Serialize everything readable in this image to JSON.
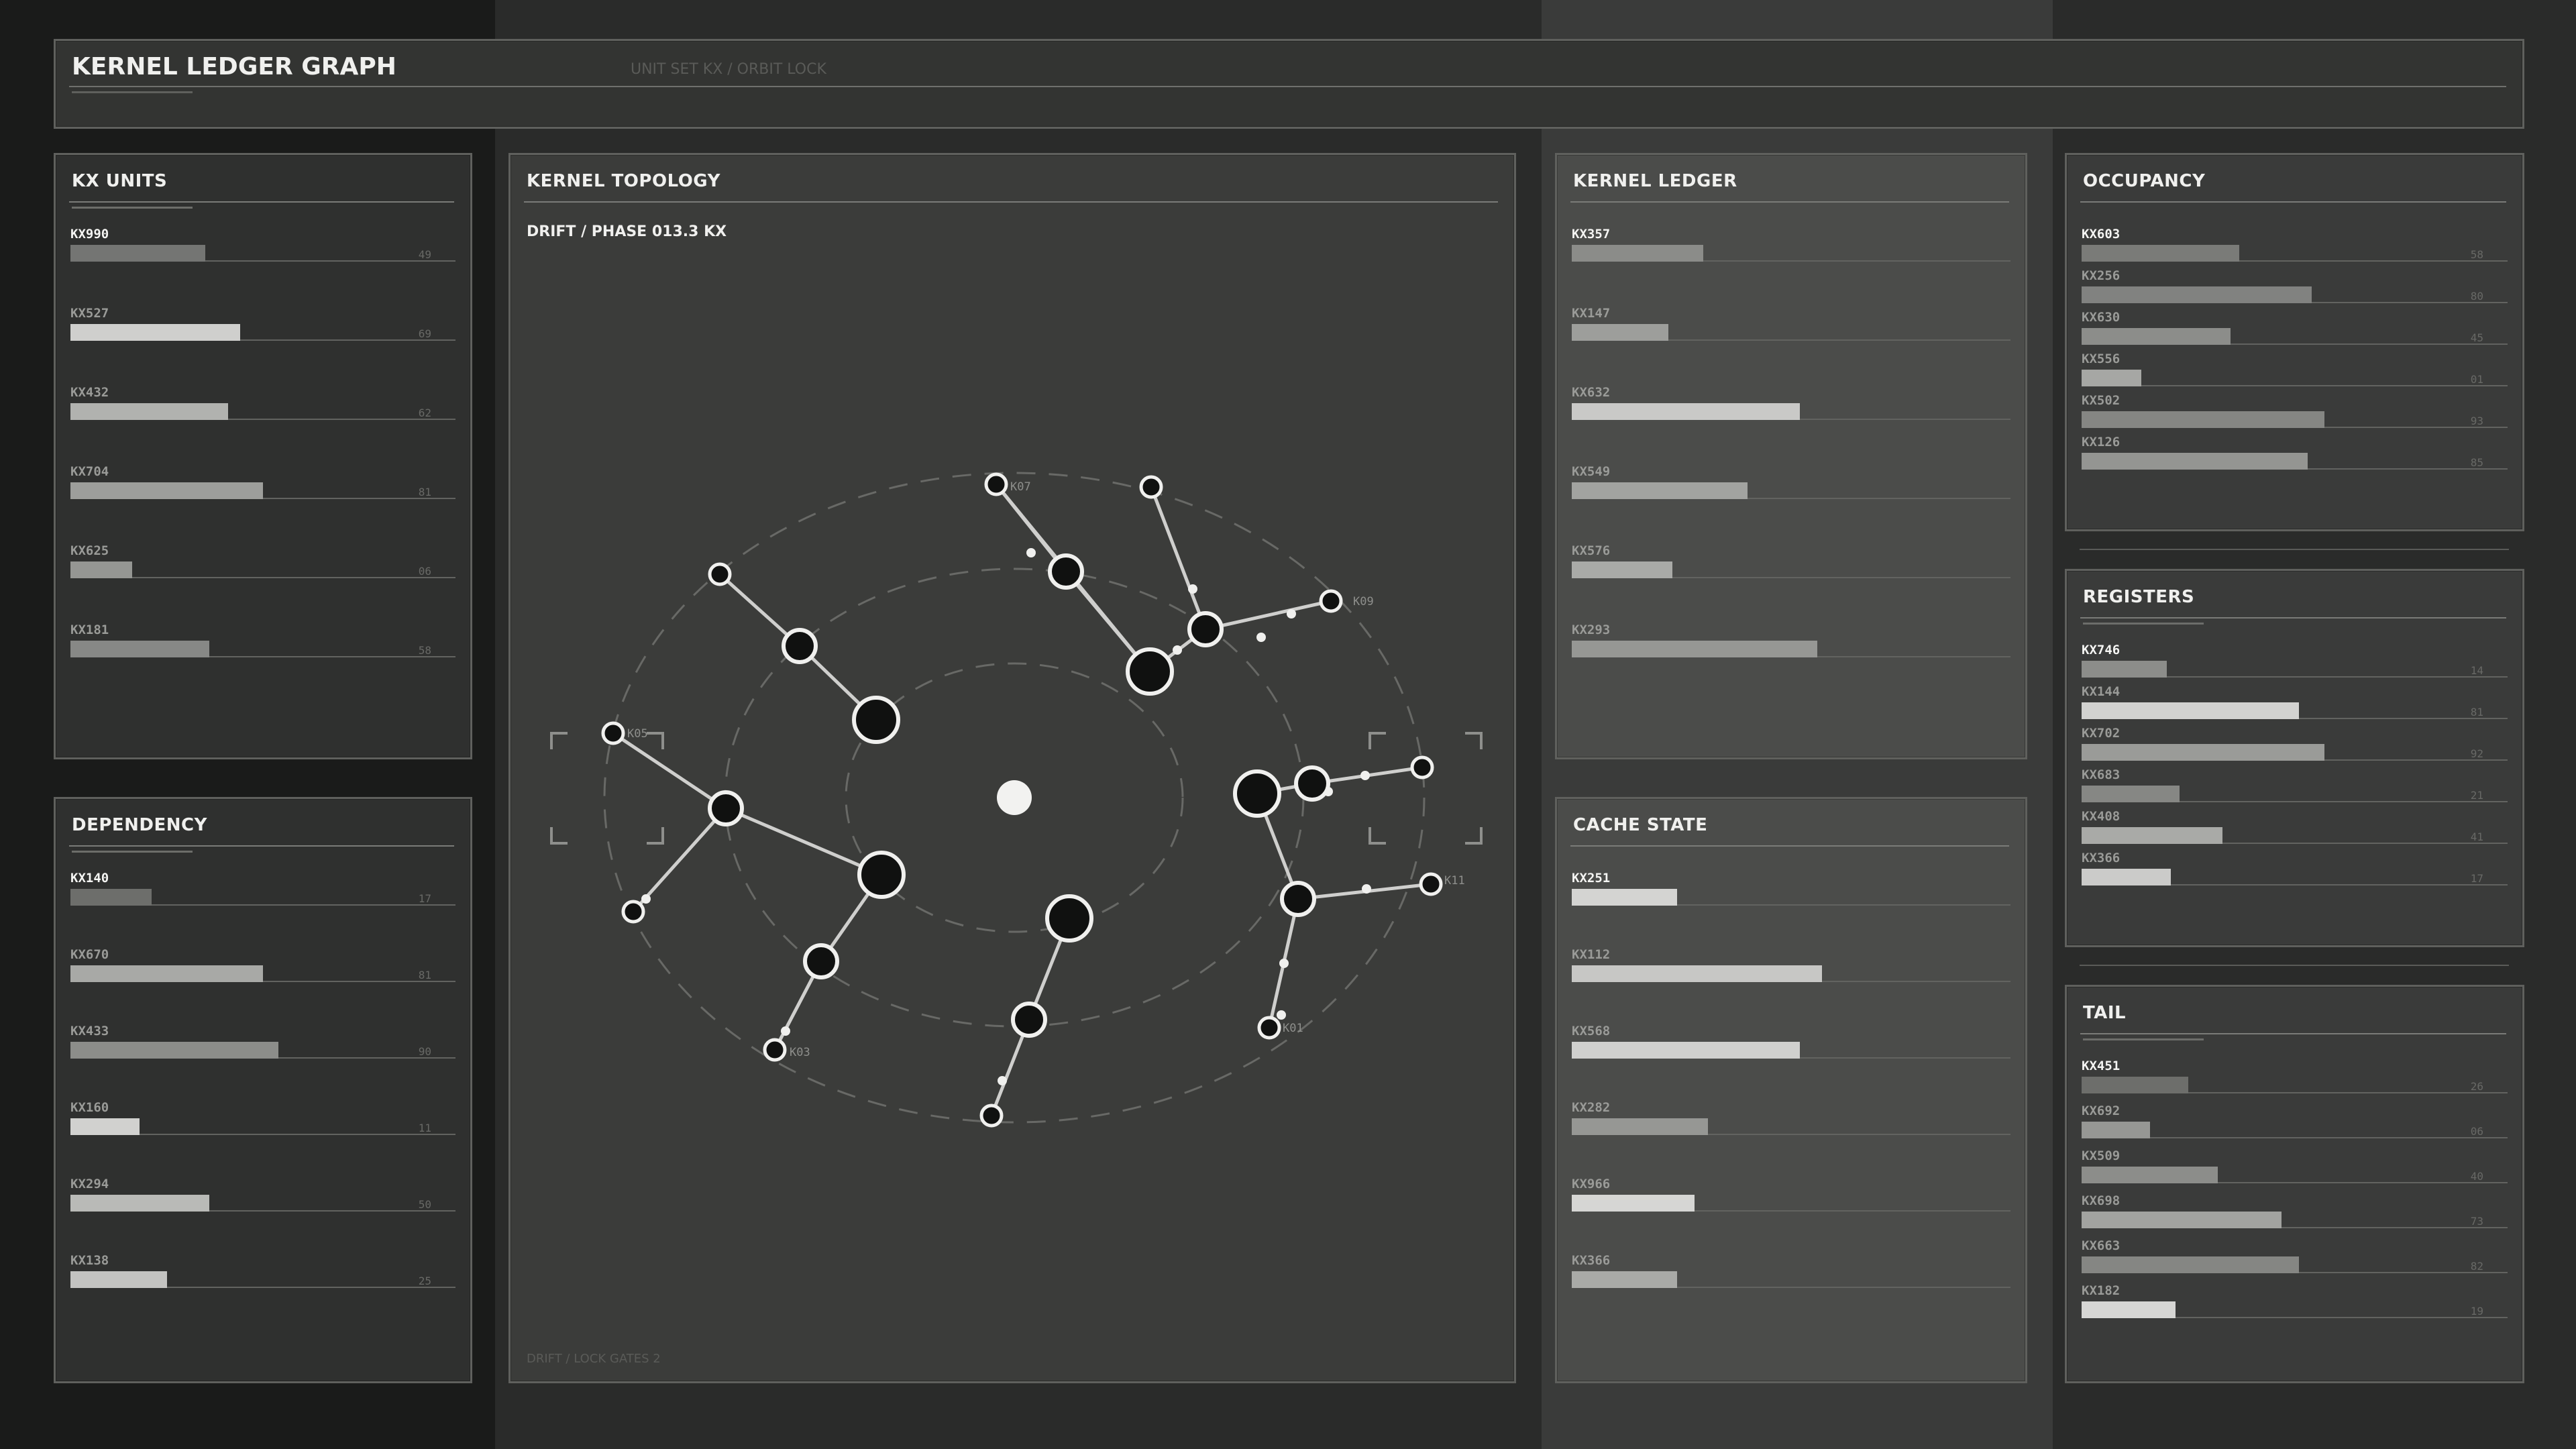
{
  "header": {
    "title": "KERNEL LEDGER GRAPH",
    "subtitle": "UNIT SET KX / ORBIT LOCK"
  },
  "panels": {
    "kx_units": {
      "title": "KX UNITS",
      "rows": [
        {
          "label": "KX990",
          "value": "49",
          "pct": 0.35,
          "color": "#747573"
        },
        {
          "label": "KX527",
          "value": "69",
          "pct": 0.44,
          "color": "#cfcfcd"
        },
        {
          "label": "KX432",
          "value": "62",
          "pct": 0.41,
          "color": "#b1b2af"
        },
        {
          "label": "KX704",
          "value": "81",
          "pct": 0.5,
          "color": "#9d9e9b"
        },
        {
          "label": "KX625",
          "value": "06",
          "pct": 0.16,
          "color": "#959693"
        },
        {
          "label": "KX181",
          "value": "58",
          "pct": 0.36,
          "color": "#878886"
        }
      ]
    },
    "dependency": {
      "title": "DEPENDENCY",
      "rows": [
        {
          "label": "KX140",
          "value": "17",
          "pct": 0.21,
          "color": "#6d6e6b"
        },
        {
          "label": "KX670",
          "value": "81",
          "pct": 0.5,
          "color": "#a8a9a6"
        },
        {
          "label": "KX433",
          "value": "90",
          "pct": 0.54,
          "color": "#8c8d8a"
        },
        {
          "label": "KX160",
          "value": "11",
          "pct": 0.18,
          "color": "#d1d1cf"
        },
        {
          "label": "KX294",
          "value": "50",
          "pct": 0.36,
          "color": "#b9bab7"
        },
        {
          "label": "KX138",
          "value": "25",
          "pct": 0.25,
          "color": "#c3c3c1"
        }
      ]
    },
    "kernel_ledger": {
      "title": "KERNEL LEDGER",
      "rows": [
        {
          "label": "KX357",
          "value": "",
          "pct": 0.3,
          "color": "#8b8c89"
        },
        {
          "label": "KX147",
          "value": "",
          "pct": 0.22,
          "color": "#9d9e9b"
        },
        {
          "label": "KX632",
          "value": "",
          "pct": 0.52,
          "color": "#c9c9c7"
        },
        {
          "label": "KX549",
          "value": "",
          "pct": 0.4,
          "color": "#a2a3a0"
        },
        {
          "label": "KX576",
          "value": "",
          "pct": 0.23,
          "color": "#a9aaa7"
        },
        {
          "label": "KX293",
          "value": "",
          "pct": 0.56,
          "color": "#969794"
        }
      ]
    },
    "cache_state": {
      "title": "CACHE STATE",
      "rows": [
        {
          "label": "KX251",
          "value": "",
          "pct": 0.24,
          "color": "#d4d4d2"
        },
        {
          "label": "KX112",
          "value": "",
          "pct": 0.57,
          "color": "#c7c7c5"
        },
        {
          "label": "KX568",
          "value": "",
          "pct": 0.52,
          "color": "#d0d0ce"
        },
        {
          "label": "KX282",
          "value": "",
          "pct": 0.31,
          "color": "#969794"
        },
        {
          "label": "KX966",
          "value": "",
          "pct": 0.28,
          "color": "#d6d6d4"
        },
        {
          "label": "KX366",
          "value": "",
          "pct": 0.24,
          "color": "#a9aaa7"
        }
      ]
    },
    "occupancy": {
      "title": "OCCUPANCY",
      "rows": [
        {
          "label": "KX603",
          "value": "58",
          "pct": 0.37,
          "color": "#7a7b78"
        },
        {
          "label": "KX256",
          "value": "80",
          "pct": 0.54,
          "color": "#818280"
        },
        {
          "label": "KX630",
          "value": "45",
          "pct": 0.35,
          "color": "#8c8d8a"
        },
        {
          "label": "KX556",
          "value": "01",
          "pct": 0.14,
          "color": "#a6a7a4"
        },
        {
          "label": "KX502",
          "value": "93",
          "pct": 0.57,
          "color": "#858683"
        },
        {
          "label": "KX126",
          "value": "85",
          "pct": 0.53,
          "color": "#949592"
        }
      ]
    },
    "registers": {
      "title": "REGISTERS",
      "rows": [
        {
          "label": "KX746",
          "value": "14",
          "pct": 0.2,
          "color": "#8c8d8a"
        },
        {
          "label": "KX144",
          "value": "81",
          "pct": 0.51,
          "color": "#d2d2d0"
        },
        {
          "label": "KX702",
          "value": "92",
          "pct": 0.57,
          "color": "#9a9b98"
        },
        {
          "label": "KX683",
          "value": "21",
          "pct": 0.23,
          "color": "#868784"
        },
        {
          "label": "KX408",
          "value": "41",
          "pct": 0.33,
          "color": "#a9aaa7"
        },
        {
          "label": "KX366",
          "value": "17",
          "pct": 0.21,
          "color": "#cbcbc9"
        }
      ]
    },
    "tail": {
      "title": "TAIL",
      "rows": [
        {
          "label": "KX451",
          "value": "26",
          "pct": 0.25,
          "color": "#6d6e6b"
        },
        {
          "label": "KX692",
          "value": "06",
          "pct": 0.16,
          "color": "#969794"
        },
        {
          "label": "KX509",
          "value": "40",
          "pct": 0.32,
          "color": "#8c8d8a"
        },
        {
          "label": "KX698",
          "value": "73",
          "pct": 0.47,
          "color": "#a2a3a0"
        },
        {
          "label": "KX663",
          "value": "82",
          "pct": 0.51,
          "color": "#858683"
        },
        {
          "label": "KX182",
          "value": "19",
          "pct": 0.22,
          "color": "#d6d6d4"
        }
      ]
    }
  },
  "topology": {
    "title": "KERNEL TOPOLOGY",
    "subtitle": "DRIFT / PHASE 013.3 KX",
    "footer": "DRIFT / LOCK GATES 2",
    "node_labels": [
      "K07",
      "K09",
      "K05",
      "K03",
      "K01",
      "K11"
    ]
  }
}
